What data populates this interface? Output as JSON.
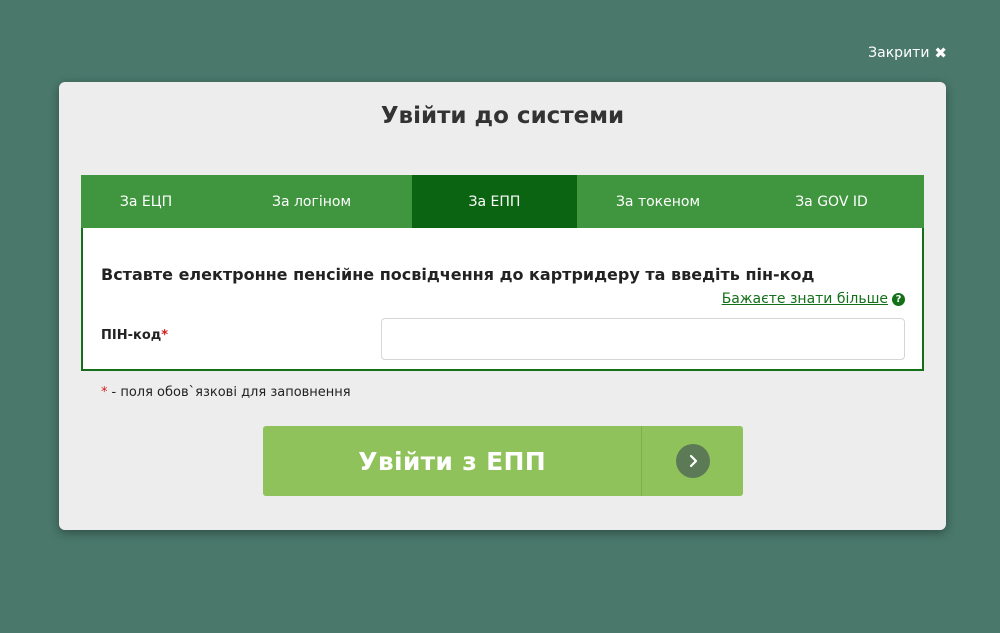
{
  "header": {
    "close_label": "Закрити",
    "close_icon": "✖"
  },
  "modal": {
    "title": "Увійти до системи"
  },
  "tabs": [
    {
      "label": "За ЕЦП",
      "active": false
    },
    {
      "label": "За логіном",
      "active": false
    },
    {
      "label": "За ЕПП",
      "active": true
    },
    {
      "label": "За токеном",
      "active": false
    },
    {
      "label": "За GOV ID",
      "active": false
    }
  ],
  "panel": {
    "instruction": "Вставте електронне пенсійне посвідчення до картридеру та введіть пін-код",
    "learn_more": "Бажаєте знати більше",
    "help_icon": "?",
    "pin_label": "ПІН-код",
    "required_mark": "*",
    "pin_value": "",
    "pin_placeholder": ""
  },
  "required_note": {
    "star": "*",
    "text": "- поля обов`язкові для заповнення"
  },
  "submit": {
    "label": "Увійти з ЕПП"
  },
  "colors": {
    "background": "#4a786b",
    "modal_bg": "#ededee",
    "tab_bg": "#3f963f",
    "tab_active_bg": "#0a6411",
    "panel_border": "#137018",
    "button_bg": "#8fc25b",
    "required": "#d01c1c"
  }
}
